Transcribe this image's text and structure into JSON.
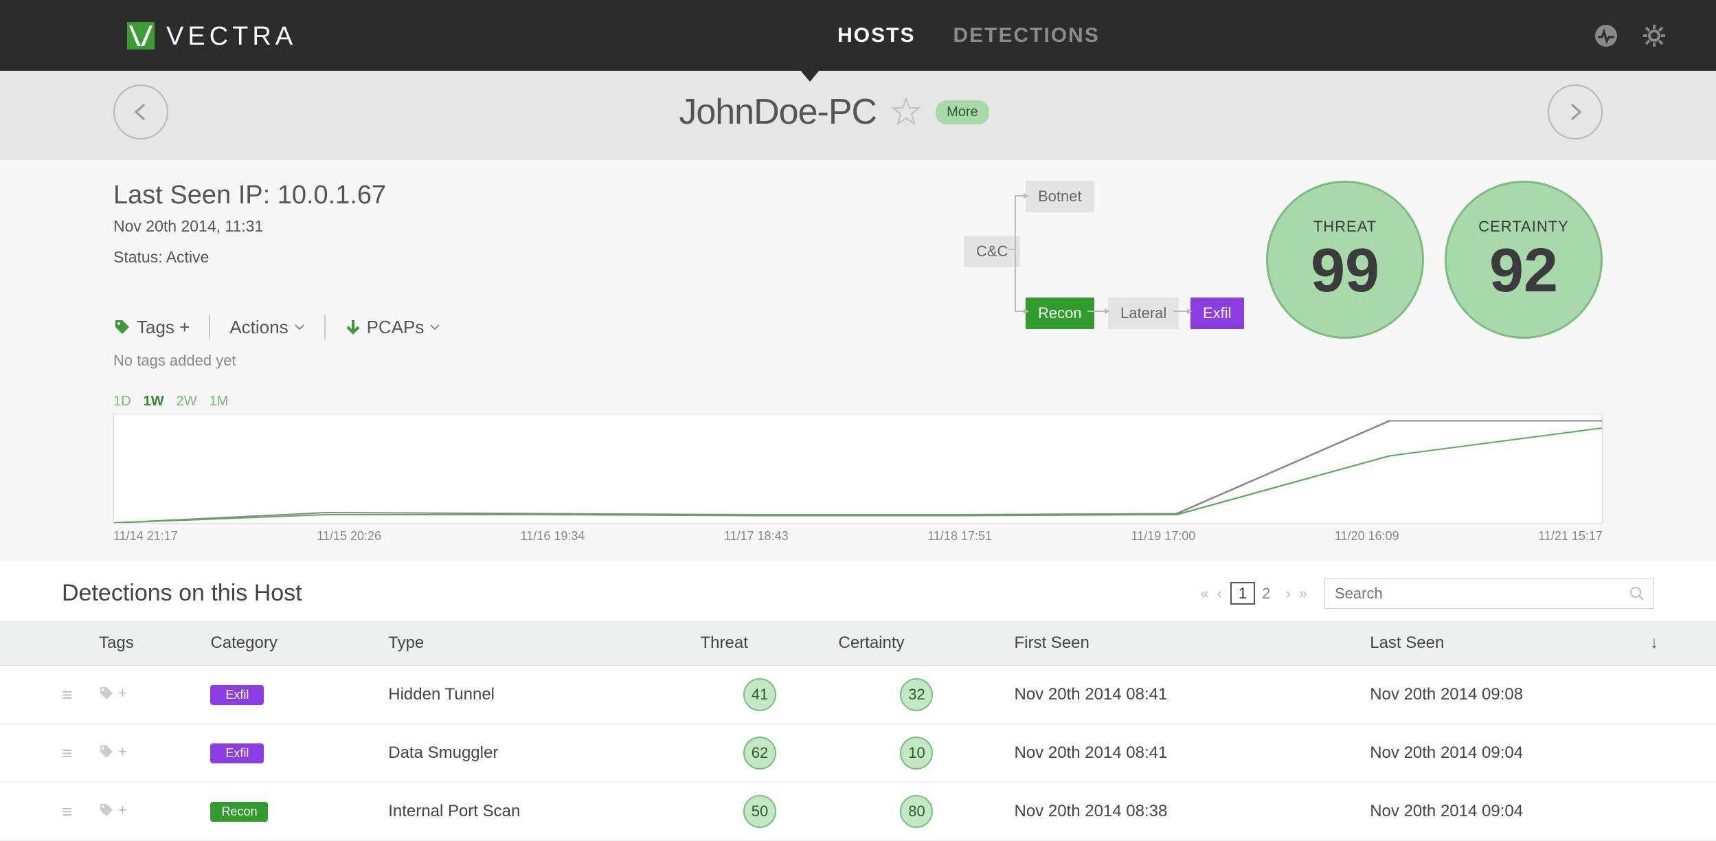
{
  "nav": {
    "brand": "VECTRA",
    "links": {
      "hosts": "HOSTS",
      "detections": "DETECTIONS"
    }
  },
  "host": {
    "name": "JohnDoe-PC",
    "more": "More",
    "last_seen_ip_label": "Last Seen IP: ",
    "last_seen_ip": "10.0.1.67",
    "timestamp": "Nov 20th 2014, 11:31",
    "status_label": "Status: ",
    "status_value": "Active",
    "tags_label": "Tags +",
    "actions_label": "Actions",
    "pcaps_label": "PCAPs",
    "no_tags": "No tags added yet"
  },
  "flow_nodes": [
    "Botnet",
    "C&C",
    "Recon",
    "Lateral",
    "Exfil"
  ],
  "scores": {
    "threat_label": "THREAT",
    "threat_value": "99",
    "certainty_label": "CERTAINTY",
    "certainty_value": "92"
  },
  "chart_ranges": [
    "1D",
    "1W",
    "2W",
    "1M"
  ],
  "chart_active_range": "1W",
  "chart_data": {
    "type": "line",
    "title": "",
    "xlabel": "",
    "ylabel": "",
    "categories": [
      "11/14 21:17",
      "11/15 20:26",
      "11/16 19:34",
      "11/17 18:43",
      "11/18 17:51",
      "11/19 17:00",
      "11/20 16:09",
      "11/21 15:17"
    ],
    "ylim": [
      0,
      100
    ],
    "series": [
      {
        "name": "Threat",
        "color": "#888888",
        "values": [
          0,
          10,
          9,
          8,
          8,
          9,
          99,
          99
        ]
      },
      {
        "name": "Certainty",
        "color": "#55b055",
        "values": [
          0,
          8,
          8,
          7,
          7,
          8,
          65,
          92
        ]
      }
    ]
  },
  "detections": {
    "title": "Detections on this Host",
    "search_placeholder": "Search",
    "pages": [
      "1",
      "2"
    ],
    "active_page": "1",
    "columns": [
      "Tags",
      "Category",
      "Type",
      "Threat",
      "Certainty",
      "First Seen",
      "Last Seen"
    ],
    "rows": [
      {
        "category": "Exfil",
        "cat_class": "exfil",
        "type": "Hidden Tunnel",
        "threat": "41",
        "certainty": "32",
        "first": "Nov 20th 2014 08:41",
        "last": "Nov 20th 2014 09:08"
      },
      {
        "category": "Exfil",
        "cat_class": "exfil",
        "type": "Data Smuggler",
        "threat": "62",
        "certainty": "10",
        "first": "Nov 20th 2014 08:41",
        "last": "Nov 20th 2014 09:04"
      },
      {
        "category": "Recon",
        "cat_class": "recon",
        "type": "Internal Port Scan",
        "threat": "50",
        "certainty": "80",
        "first": "Nov 20th 2014 08:38",
        "last": "Nov 20th 2014 09:04"
      }
    ]
  }
}
